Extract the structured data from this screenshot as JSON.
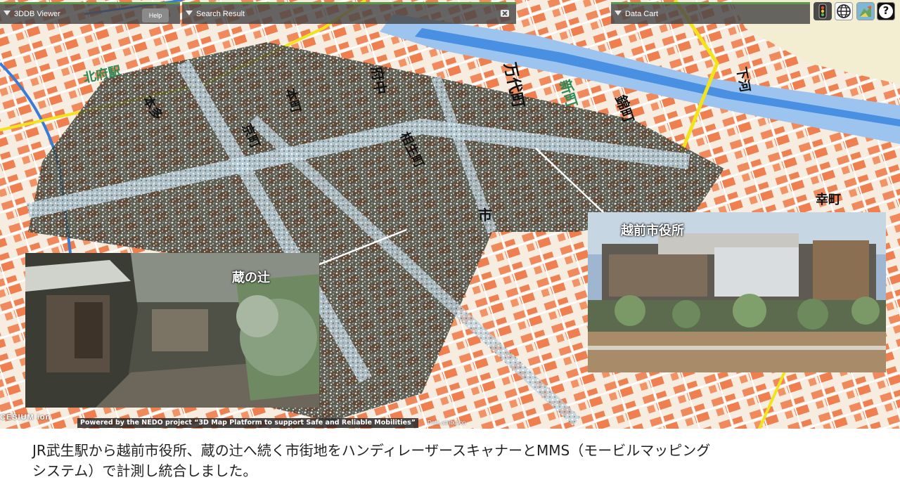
{
  "viewer_panel": {
    "title": "3DDB Viewer",
    "help_label": "Help"
  },
  "search_panel": {
    "title": "Search Result"
  },
  "cart_panel": {
    "title": "Data Cart"
  },
  "toolbar": {
    "icons": [
      "traffic-light-icon",
      "globe-icon",
      "map-layers-icon",
      "help-icon"
    ],
    "help_glyph": "?"
  },
  "map": {
    "labels": [
      "北府駅",
      "本多",
      "万代町",
      "新町",
      "錦町",
      "府中",
      "本町",
      "市",
      "下河",
      "幸町",
      "京町",
      "相生町"
    ],
    "colors": {
      "ground": "#f3e6d6",
      "building": "#f08a5d",
      "road": "#ffffff",
      "rail": "#3a7bd5",
      "highway": "#f2e31a",
      "river": "#4a90e2",
      "point_cloud": "#e0ecf2"
    }
  },
  "annotations": {
    "kura_label": "蔵の辻",
    "cityhall_label": "越前市役所"
  },
  "attribution": {
    "cesium": "CESIUM ion",
    "nedo": "Powered by the NEDO project “3D Map Platform to support Safe and Reliable Mobilities”",
    "data": "Data attribution"
  },
  "caption": {
    "line1": "JR武生駅から越前市役所、蔵の辻へ続く市街地をハンディレーザースキャナーとMMS（モービルマッピング",
    "line2": "システム）で計測し統合しました。"
  }
}
